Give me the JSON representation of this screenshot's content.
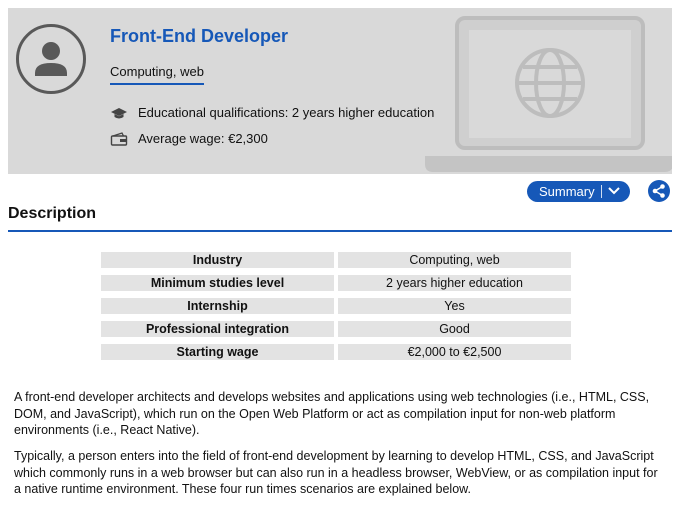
{
  "job": {
    "title": "Front-End Developer",
    "field": "Computing, web",
    "education_label": "Educational qualifications: 2 years higher education",
    "wage_label": "Average wage: €2,300"
  },
  "actions": {
    "summary_label": "Summary"
  },
  "description": {
    "heading": "Description",
    "facts": [
      {
        "label": "Industry",
        "value": "Computing, web"
      },
      {
        "label": "Minimum studies level",
        "value": "2 years higher education"
      },
      {
        "label": "Internship",
        "value": "Yes"
      },
      {
        "label": "Professional integration",
        "value": "Good"
      },
      {
        "label": "Starting wage",
        "value": "€2,000 to €2,500"
      }
    ],
    "paragraphs": [
      "A front-end developer architects and develops websites and applications using web technologies (i.e., HTML, CSS, DOM, and JavaScript), which run on the Open Web Platform or act as compilation input for non-web platform environments (i.e., React Native).",
      "Typically, a person enters into the field of front-end development by learning to develop HTML, CSS, and JavaScript which commonly runs in a web browser but can also run in a headless browser, WebView, or as compilation input for a native runtime environment. These four run times scenarios are explained below."
    ]
  },
  "colors": {
    "accent": "#1658b8",
    "hero_bg": "#d9d9d9",
    "table_cell_bg": "#e3e3e3"
  },
  "icons": {
    "avatar": "user-avatar-icon",
    "education": "graduation-cap-icon",
    "wage": "wallet-icon",
    "summary": "chevron-down-icon",
    "share": "share-icon",
    "illustration": "laptop-globe-icon"
  }
}
